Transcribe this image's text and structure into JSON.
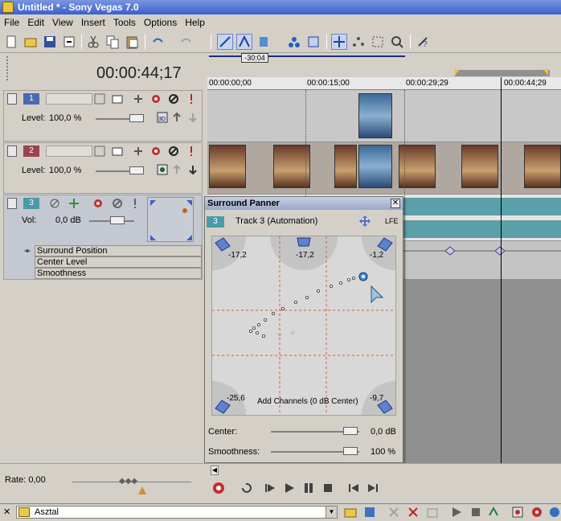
{
  "window": {
    "title": "Untitled * - Sony Vegas 7.0"
  },
  "menu": [
    "File",
    "Edit",
    "View",
    "Insert",
    "Tools",
    "Options",
    "Help"
  ],
  "timecode": "00:00:44;17",
  "ruler": {
    "marker": "-30:04",
    "ticks": [
      "00:00:00;00",
      "00:00:15;00",
      "00:00:29;29",
      "00:00:44;29"
    ]
  },
  "tracks": [
    {
      "number": "1",
      "level_label": "Level:",
      "level_value": "100,0 %",
      "color": "#4a6ab0"
    },
    {
      "number": "2",
      "level_label": "Level:",
      "level_value": "100,0 %",
      "color": "#a04050"
    },
    {
      "number": "3",
      "vol_label": "Vol:",
      "vol_value": "0,0 dB",
      "color": "#4a9aa8",
      "envelopes": [
        "Surround Position",
        "Center Level",
        "Smoothness"
      ]
    }
  ],
  "panner": {
    "title": "Surround Panner",
    "track_num": "3",
    "track_label": "Track 3 (Automation)",
    "lfe_label": "LFE",
    "speakers": {
      "front_left": "-17,2",
      "center": "-17,2",
      "front_right": "-1,2",
      "rear_left": "-25,6",
      "rear_right": "-9,7"
    },
    "add_channels": "Add Channels (0 dB Center)",
    "center_label": "Center:",
    "center_value": "0,0 dB",
    "smoothness_label": "Smoothness:",
    "smoothness_value": "100 %"
  },
  "rate": {
    "label": "Rate: 0,00"
  },
  "statusbar": {
    "path": "Asztal"
  }
}
